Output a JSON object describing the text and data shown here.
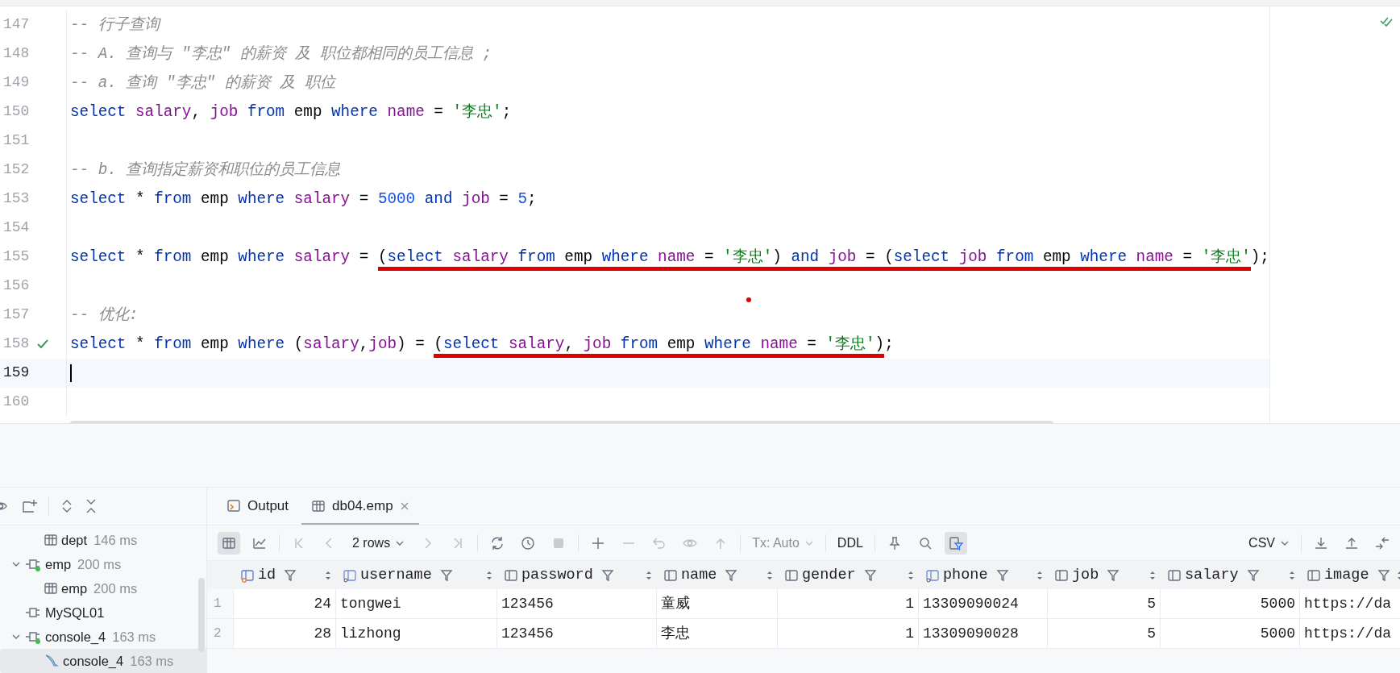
{
  "editor": {
    "lines": [
      {
        "number": "147",
        "current": false,
        "executed": false,
        "tokens": [
          {
            "text": "-- 行子查询",
            "kind": "comment"
          }
        ]
      },
      {
        "number": "148",
        "current": false,
        "executed": false,
        "tokens": [
          {
            "text": "-- A. 查询与 \"李忠\" 的薪资 及 职位都相同的员工信息 ;",
            "kind": "comment"
          }
        ]
      },
      {
        "number": "149",
        "current": false,
        "executed": false,
        "tokens": [
          {
            "text": "-- a. 查询 \"李忠\" 的薪资 及 职位",
            "kind": "comment"
          }
        ]
      },
      {
        "number": "150",
        "current": false,
        "executed": false,
        "tokens": [
          {
            "text": "select ",
            "kind": "keyword"
          },
          {
            "text": "salary",
            "kind": "field"
          },
          {
            "text": ", ",
            "kind": "plain"
          },
          {
            "text": "job ",
            "kind": "field"
          },
          {
            "text": "from ",
            "kind": "keyword"
          },
          {
            "text": "emp ",
            "kind": "plain"
          },
          {
            "text": "where ",
            "kind": "keyword"
          },
          {
            "text": "name",
            "kind": "field"
          },
          {
            "text": " = ",
            "kind": "plain"
          },
          {
            "text": "'李忠'",
            "kind": "string"
          },
          {
            "text": ";",
            "kind": "plain"
          }
        ]
      },
      {
        "number": "151",
        "current": false,
        "executed": false
      },
      {
        "number": "152",
        "current": false,
        "executed": false,
        "tokens": [
          {
            "text": "-- b. 查询指定薪资和职位的员工信息",
            "kind": "comment"
          }
        ]
      },
      {
        "number": "153",
        "current": false,
        "executed": false,
        "tokens": [
          {
            "text": "select ",
            "kind": "keyword"
          },
          {
            "text": "* ",
            "kind": "plain"
          },
          {
            "text": "from ",
            "kind": "keyword"
          },
          {
            "text": "emp ",
            "kind": "plain"
          },
          {
            "text": "where ",
            "kind": "keyword"
          },
          {
            "text": "salary",
            "kind": "field"
          },
          {
            "text": " = ",
            "kind": "plain"
          },
          {
            "text": "5000 ",
            "kind": "number"
          },
          {
            "text": "and ",
            "kind": "keyword"
          },
          {
            "text": "job",
            "kind": "field"
          },
          {
            "text": " = ",
            "kind": "plain"
          },
          {
            "text": "5",
            "kind": "number"
          },
          {
            "text": ";",
            "kind": "plain"
          }
        ]
      },
      {
        "number": "154",
        "current": false,
        "executed": false
      },
      {
        "number": "155",
        "current": false,
        "executed": false,
        "segments": [
          {
            "underlined": false,
            "tokens": [
              {
                "text": "select ",
                "kind": "keyword"
              },
              {
                "text": "* ",
                "kind": "plain"
              },
              {
                "text": "from ",
                "kind": "keyword"
              },
              {
                "text": "emp ",
                "kind": "plain"
              },
              {
                "text": "where ",
                "kind": "keyword"
              },
              {
                "text": "salary",
                "kind": "field"
              },
              {
                "text": " = ",
                "kind": "plain"
              }
            ]
          },
          {
            "underlined": true,
            "tokens": [
              {
                "text": "(",
                "kind": "plain"
              },
              {
                "text": "select ",
                "kind": "keyword"
              },
              {
                "text": "salary ",
                "kind": "field"
              },
              {
                "text": "from ",
                "kind": "keyword"
              },
              {
                "text": "emp ",
                "kind": "plain"
              },
              {
                "text": "where ",
                "kind": "keyword"
              },
              {
                "text": "name",
                "kind": "field"
              },
              {
                "text": " = ",
                "kind": "plain"
              },
              {
                "text": "'李忠'",
                "kind": "string"
              },
              {
                "text": ") ",
                "kind": "plain"
              },
              {
                "text": "and ",
                "kind": "keyword"
              },
              {
                "text": "job",
                "kind": "field"
              },
              {
                "text": " = (",
                "kind": "plain"
              },
              {
                "text": "select ",
                "kind": "keyword"
              },
              {
                "text": "job ",
                "kind": "field"
              },
              {
                "text": "from ",
                "kind": "keyword"
              },
              {
                "text": "emp ",
                "kind": "plain"
              },
              {
                "text": "where ",
                "kind": "keyword"
              },
              {
                "text": "name",
                "kind": "field"
              },
              {
                "text": " = ",
                "kind": "plain"
              },
              {
                "text": "'李忠'",
                "kind": "string"
              }
            ]
          },
          {
            "underlined": false,
            "tokens": [
              {
                "text": ");",
                "kind": "plain"
              }
            ]
          }
        ]
      },
      {
        "number": "156",
        "current": false,
        "executed": false
      },
      {
        "number": "157",
        "current": false,
        "executed": false,
        "tokens": [
          {
            "text": "-- 优化:",
            "kind": "comment"
          }
        ]
      },
      {
        "number": "158",
        "current": false,
        "executed": true,
        "segments": [
          {
            "underlined": false,
            "tokens": [
              {
                "text": "select ",
                "kind": "keyword"
              },
              {
                "text": "* ",
                "kind": "plain"
              },
              {
                "text": "from ",
                "kind": "keyword"
              },
              {
                "text": "emp ",
                "kind": "plain"
              },
              {
                "text": "where ",
                "kind": "keyword"
              },
              {
                "text": "(",
                "kind": "plain"
              },
              {
                "text": "salary",
                "kind": "field"
              },
              {
                "text": ",",
                "kind": "plain"
              },
              {
                "text": "job",
                "kind": "field"
              },
              {
                "text": ") = ",
                "kind": "plain"
              }
            ]
          },
          {
            "underlined": true,
            "tokens": [
              {
                "text": "(",
                "kind": "plain"
              },
              {
                "text": "select ",
                "kind": "keyword"
              },
              {
                "text": "salary",
                "kind": "field"
              },
              {
                "text": ", ",
                "kind": "plain"
              },
              {
                "text": "job ",
                "kind": "field"
              },
              {
                "text": "from ",
                "kind": "keyword"
              },
              {
                "text": "emp ",
                "kind": "plain"
              },
              {
                "text": "where ",
                "kind": "keyword"
              },
              {
                "text": "name",
                "kind": "field"
              },
              {
                "text": " = ",
                "kind": "plain"
              },
              {
                "text": "'李忠'",
                "kind": "string"
              },
              {
                "text": ")",
                "kind": "plain"
              }
            ]
          },
          {
            "underlined": false,
            "tokens": [
              {
                "text": ";",
                "kind": "plain"
              }
            ]
          }
        ]
      },
      {
        "number": "159",
        "current": true,
        "executed": false
      },
      {
        "number": "160",
        "current": false,
        "executed": false
      }
    ]
  },
  "services_tree": [
    {
      "label": "dept",
      "time": "146 ms",
      "kind": "table",
      "selected": false
    },
    {
      "label": "emp",
      "time": "200 ms",
      "kind": "session",
      "active": true,
      "expanded": true,
      "selected": false,
      "children": [
        {
          "label": "emp",
          "time": "200 ms",
          "kind": "table",
          "selected": false
        }
      ]
    },
    {
      "label": "MySQL01",
      "kind": "session",
      "active": false,
      "selected": false
    },
    {
      "label": "console_4",
      "time": "163 ms",
      "kind": "session",
      "active": true,
      "expanded": true,
      "selected": false,
      "children": [
        {
          "label": "console_4",
          "time": "163 ms",
          "kind": "console",
          "selected": true
        }
      ]
    }
  ],
  "result_tabs": [
    {
      "label": "Output",
      "kind": "output",
      "selected": false
    },
    {
      "label": "db04.emp",
      "kind": "table",
      "selected": true
    }
  ],
  "toolbar": {
    "grid_view_on": true,
    "rows": "2 rows",
    "transaction": "Tx: Auto",
    "ddl": "DDL",
    "filter_on": true,
    "export_format": "CSV"
  },
  "table": {
    "columns": [
      {
        "name": "id",
        "kind": "key",
        "numeric": true
      },
      {
        "name": "username",
        "kind": "index",
        "numeric": false
      },
      {
        "name": "password",
        "kind": "column",
        "numeric": false
      },
      {
        "name": "name",
        "kind": "column",
        "numeric": false
      },
      {
        "name": "gender",
        "kind": "column",
        "numeric": true
      },
      {
        "name": "phone",
        "kind": "index",
        "numeric": false
      },
      {
        "name": "job",
        "kind": "column",
        "numeric": true
      },
      {
        "name": "salary",
        "kind": "column",
        "numeric": true
      },
      {
        "name": "image",
        "kind": "column",
        "numeric": false
      }
    ],
    "rows": [
      {
        "number": "1",
        "cells": [
          "24",
          "tongwei",
          "123456",
          "童威",
          "1",
          "13309090024",
          "5",
          "5000",
          "https://da"
        ]
      },
      {
        "number": "2",
        "cells": [
          "28",
          "lizhong",
          "123456",
          "李忠",
          "1",
          "13309090028",
          "5",
          "5000",
          "https://da"
        ]
      }
    ]
  }
}
